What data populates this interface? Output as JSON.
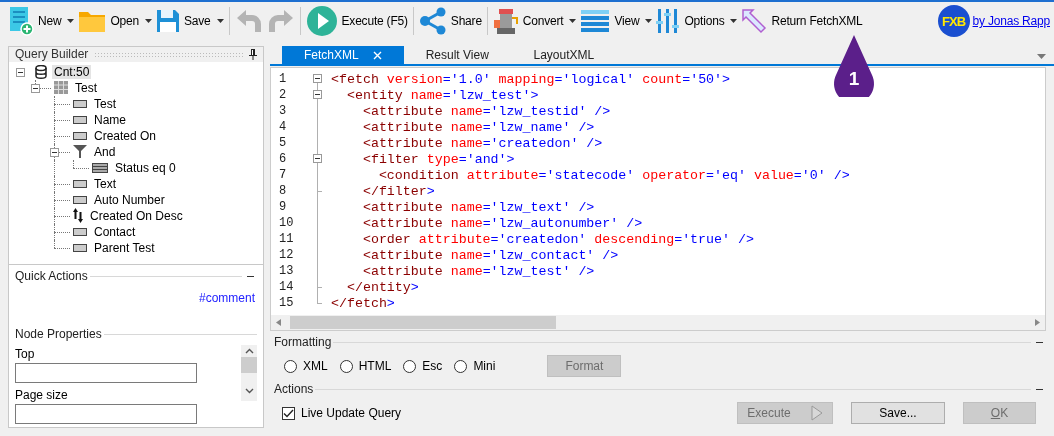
{
  "toolbar": {
    "groups": [
      [
        {
          "label": "New",
          "dropdown": true,
          "disabled": false
        },
        {
          "label": "Open",
          "dropdown": true,
          "disabled": false
        },
        {
          "label": "Save",
          "dropdown": true,
          "disabled": false
        }
      ],
      [
        {
          "dropdown": false,
          "disabled": true
        },
        {
          "dropdown": false,
          "disabled": true
        }
      ],
      [
        {
          "label": "Execute (F5)",
          "dropdown": false,
          "disabled": false
        }
      ],
      [
        {
          "label": "Share",
          "dropdown": false,
          "disabled": false
        }
      ],
      [
        {
          "label": "Convert",
          "dropdown": true,
          "disabled": false
        },
        {
          "label": "View",
          "dropdown": true,
          "disabled": false
        },
        {
          "label": "Options",
          "dropdown": true,
          "disabled": false
        },
        {
          "label": "Return FetchXML",
          "dropdown": false,
          "disabled": false
        }
      ]
    ],
    "logo": "FXB",
    "author_link": "by Jonas Rapp"
  },
  "callout": "1",
  "query_builder": {
    "title": "Query Builder",
    "tree": [
      {
        "label": "Cnt:50",
        "kind": "fetch",
        "selected": true,
        "expanded": true,
        "children": [
          {
            "label": "Test",
            "kind": "entity",
            "selected": false,
            "expanded": true,
            "children": [
              {
                "label": "Test",
                "kind": "attribute",
                "selected": false
              },
              {
                "label": "Name",
                "kind": "attribute",
                "selected": false
              },
              {
                "label": "Created On",
                "kind": "attribute",
                "selected": false
              },
              {
                "label": "And",
                "kind": "filter",
                "selected": false,
                "expanded": true,
                "children": [
                  {
                    "label": "Status eq 0",
                    "kind": "condition",
                    "selected": false
                  }
                ]
              },
              {
                "label": "Text",
                "kind": "attribute",
                "selected": false
              },
              {
                "label": "Auto Number",
                "kind": "attribute",
                "selected": false
              },
              {
                "label": "Created On Desc",
                "kind": "order",
                "selected": false
              },
              {
                "label": "Contact",
                "kind": "attribute",
                "selected": false
              },
              {
                "label": "Parent Test",
                "kind": "attribute",
                "selected": false
              }
            ]
          }
        ]
      }
    ]
  },
  "quick_actions": {
    "title": "Quick Actions",
    "link": "#comment"
  },
  "node_properties": {
    "title": "Node Properties",
    "fields": [
      {
        "label": "Top"
      },
      {
        "label": "Page size"
      }
    ]
  },
  "tabs": [
    {
      "label": "FetchXML",
      "selected": true,
      "closable": true
    },
    {
      "label": "Result View",
      "selected": false,
      "closable": false
    },
    {
      "label": "LayoutXML",
      "selected": false,
      "closable": false
    }
  ],
  "editor": {
    "lines": [
      {
        "number": "1",
        "kind": "start",
        "tokens": [
          {
            "kind": "tag",
            "text": "<fetch"
          },
          {
            "kind": "attr",
            "text": " version"
          },
          {
            "kind": "punct",
            "text": "="
          },
          {
            "kind": "value",
            "text": "'1.0'"
          },
          {
            "kind": "attr",
            "text": " mapping"
          },
          {
            "kind": "punct",
            "text": "="
          },
          {
            "kind": "value",
            "text": "'logical'"
          },
          {
            "kind": "attr",
            "text": " count"
          },
          {
            "kind": "punct",
            "text": "="
          },
          {
            "kind": "value",
            "text": "'50'"
          },
          {
            "kind": "punct",
            "text": ">"
          }
        ]
      },
      {
        "number": "2",
        "kind": "start",
        "tokens": [
          {
            "kind": "tag",
            "text": "  <entity"
          },
          {
            "kind": "attr",
            "text": " name"
          },
          {
            "kind": "punct",
            "text": "="
          },
          {
            "kind": "value",
            "text": "'lzw_test'"
          },
          {
            "kind": "punct",
            "text": ">"
          }
        ]
      },
      {
        "number": "3",
        "kind": "line",
        "tokens": [
          {
            "kind": "tag",
            "text": "    <attribute"
          },
          {
            "kind": "attr",
            "text": " name"
          },
          {
            "kind": "punct",
            "text": "="
          },
          {
            "kind": "value",
            "text": "'lzw_testid'"
          },
          {
            "kind": "punct",
            "text": " />"
          }
        ]
      },
      {
        "number": "4",
        "kind": "line",
        "tokens": [
          {
            "kind": "tag",
            "text": "    <attribute"
          },
          {
            "kind": "attr",
            "text": " name"
          },
          {
            "kind": "punct",
            "text": "="
          },
          {
            "kind": "value",
            "text": "'lzw_name'"
          },
          {
            "kind": "punct",
            "text": " />"
          }
        ]
      },
      {
        "number": "5",
        "kind": "line",
        "tokens": [
          {
            "kind": "tag",
            "text": "    <attribute"
          },
          {
            "kind": "attr",
            "text": " name"
          },
          {
            "kind": "punct",
            "text": "="
          },
          {
            "kind": "value",
            "text": "'createdon'"
          },
          {
            "kind": "punct",
            "text": " />"
          }
        ]
      },
      {
        "number": "6",
        "kind": "start",
        "tokens": [
          {
            "kind": "tag",
            "text": "    <filter"
          },
          {
            "kind": "attr",
            "text": " type"
          },
          {
            "kind": "punct",
            "text": "="
          },
          {
            "kind": "value",
            "text": "'and'"
          },
          {
            "kind": "punct",
            "text": ">"
          }
        ]
      },
      {
        "number": "7",
        "kind": "line",
        "tokens": [
          {
            "kind": "tag",
            "text": "      <condition"
          },
          {
            "kind": "attr",
            "text": " attribute"
          },
          {
            "kind": "punct",
            "text": "="
          },
          {
            "kind": "value",
            "text": "'statecode'"
          },
          {
            "kind": "attr",
            "text": " operator"
          },
          {
            "kind": "punct",
            "text": "="
          },
          {
            "kind": "value",
            "text": "'eq'"
          },
          {
            "kind": "attr",
            "text": " value"
          },
          {
            "kind": "punct",
            "text": "="
          },
          {
            "kind": "value",
            "text": "'0'"
          },
          {
            "kind": "punct",
            "text": " />"
          }
        ]
      },
      {
        "number": "8",
        "kind": "end",
        "tokens": [
          {
            "kind": "tag",
            "text": "    </filter"
          },
          {
            "kind": "punct",
            "text": ">"
          }
        ]
      },
      {
        "number": "9",
        "kind": "line",
        "tokens": [
          {
            "kind": "tag",
            "text": "    <attribute"
          },
          {
            "kind": "attr",
            "text": " name"
          },
          {
            "kind": "punct",
            "text": "="
          },
          {
            "kind": "value",
            "text": "'lzw_text'"
          },
          {
            "kind": "punct",
            "text": " />"
          }
        ]
      },
      {
        "number": "10",
        "kind": "line",
        "tokens": [
          {
            "kind": "tag",
            "text": "    <attribute"
          },
          {
            "kind": "attr",
            "text": " name"
          },
          {
            "kind": "punct",
            "text": "="
          },
          {
            "kind": "value",
            "text": "'lzw_autonumber'"
          },
          {
            "kind": "punct",
            "text": " />"
          }
        ]
      },
      {
        "number": "11",
        "kind": "line",
        "tokens": [
          {
            "kind": "tag",
            "text": "    <order"
          },
          {
            "kind": "attr",
            "text": " attribute"
          },
          {
            "kind": "punct",
            "text": "="
          },
          {
            "kind": "value",
            "text": "'createdon'"
          },
          {
            "kind": "attr",
            "text": " descending"
          },
          {
            "kind": "punct",
            "text": "="
          },
          {
            "kind": "value",
            "text": "'true'"
          },
          {
            "kind": "punct",
            "text": " />"
          }
        ]
      },
      {
        "number": "12",
        "kind": "line",
        "tokens": [
          {
            "kind": "tag",
            "text": "    <attribute"
          },
          {
            "kind": "attr",
            "text": " name"
          },
          {
            "kind": "punct",
            "text": "="
          },
          {
            "kind": "value",
            "text": "'lzw_contact'"
          },
          {
            "kind": "punct",
            "text": " />"
          }
        ]
      },
      {
        "number": "13",
        "kind": "line",
        "tokens": [
          {
            "kind": "tag",
            "text": "    <attribute"
          },
          {
            "kind": "attr",
            "text": " name"
          },
          {
            "kind": "punct",
            "text": "="
          },
          {
            "kind": "value",
            "text": "'lzw_test'"
          },
          {
            "kind": "punct",
            "text": " />"
          }
        ]
      },
      {
        "number": "14",
        "kind": "end",
        "tokens": [
          {
            "kind": "tag",
            "text": "  </entity"
          },
          {
            "kind": "punct",
            "text": ">"
          }
        ]
      },
      {
        "number": "15",
        "kind": "end",
        "tokens": [
          {
            "kind": "tag",
            "text": "</fetch"
          },
          {
            "kind": "punct",
            "text": ">"
          }
        ]
      }
    ]
  },
  "formatting": {
    "title": "Formatting",
    "options": [
      {
        "label": "XML",
        "selected": false
      },
      {
        "label": "HTML",
        "selected": false
      },
      {
        "label": "Esc",
        "selected": false
      },
      {
        "label": "Mini",
        "selected": false
      }
    ],
    "format_button": {
      "label": "Format",
      "disabled": true
    }
  },
  "actions": {
    "title": "Actions",
    "live_update": {
      "label": "Live Update Query",
      "checked": true
    },
    "buttons": [
      {
        "label": "Execute",
        "kind": "execute",
        "disabled": true
      },
      {
        "label": "Save...",
        "kind": "plain",
        "disabled": false
      },
      {
        "label": "OK",
        "kind": "plain",
        "disabled": true
      }
    ]
  }
}
